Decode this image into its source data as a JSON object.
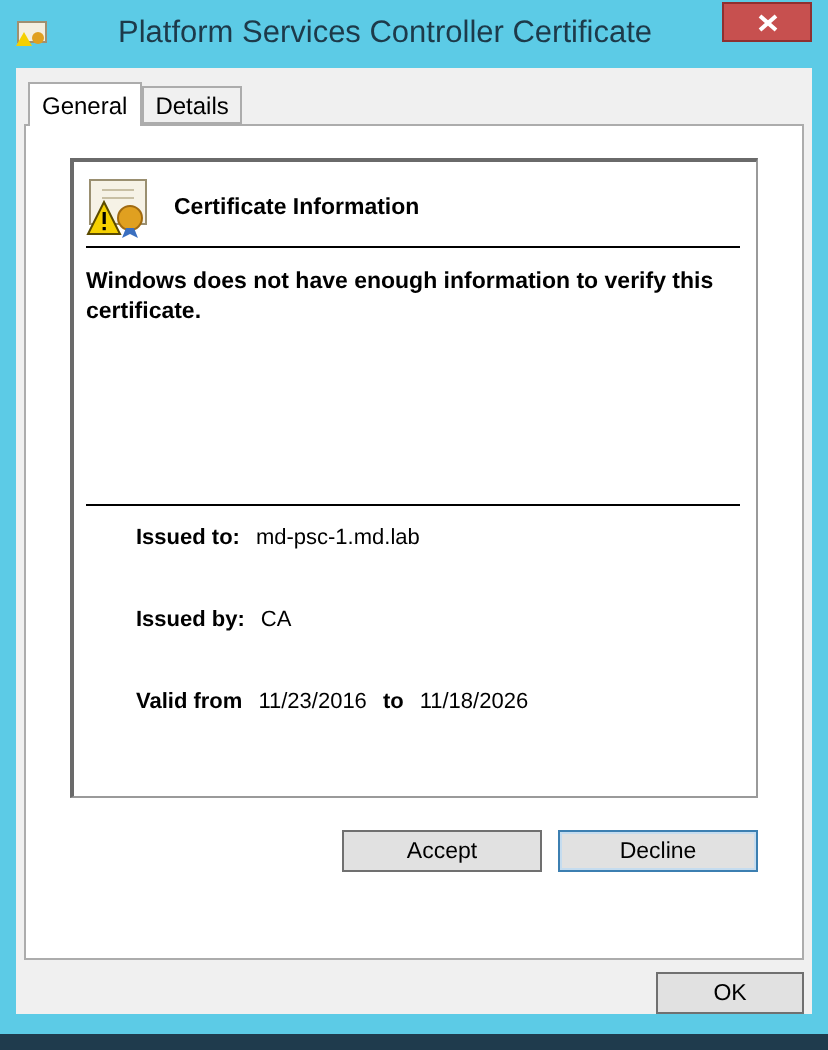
{
  "window": {
    "title": "Platform Services Controller Certificate"
  },
  "tabs": [
    {
      "label": "General",
      "selected": true
    },
    {
      "label": "Details",
      "selected": false
    }
  ],
  "certificate": {
    "heading": "Certificate Information",
    "message": "Windows does not have enough information to verify this certificate.",
    "fields": [
      {
        "label": "Issued to:",
        "value": "md-psc-1.md.lab"
      },
      {
        "label": "Issued by:",
        "value": "CA"
      }
    ],
    "validity": {
      "label": "Valid from",
      "start": "11/23/2016",
      "joiner": "to",
      "end": "11/18/2026"
    }
  },
  "panel_buttons": [
    {
      "label": "Accept",
      "default": false
    },
    {
      "label": "Decline",
      "default": true
    }
  ],
  "ok_button": "OK"
}
